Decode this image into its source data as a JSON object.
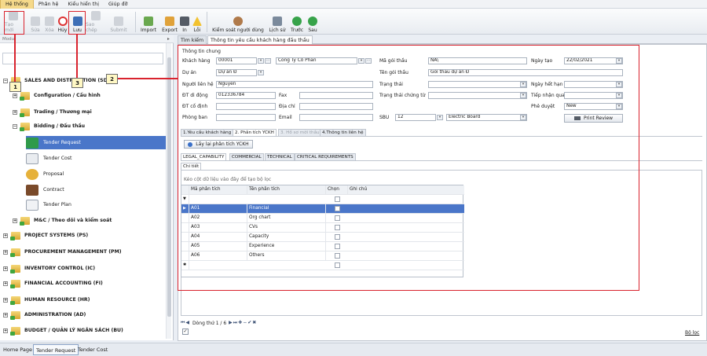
{
  "menu": [
    "Hệ thống",
    "Phân hệ",
    "Kiểu hiển thị",
    "Giúp đỡ"
  ],
  "toolbar": {
    "tao_moi": "Tạo mới",
    "sua": "Sửa",
    "xoa": "Xóa",
    "huy": "Hủy",
    "luu": "Lưu",
    "sao_chep": "Sao chép",
    "submit": "Submit",
    "import": "Import",
    "export": "Export",
    "in": "In",
    "loi": "Lỗi",
    "kiem_soat": "Kiểm soát người dùng",
    "lich_su": "Lịch sử",
    "truoc": "Trước",
    "sau": "Sau"
  },
  "left_panel": {
    "header": "Modu",
    "items": [
      {
        "label": "SALES AND DISTRIBUTION (SD)",
        "level": 0
      },
      {
        "label": "Configuration / Cấu hình",
        "level": 1
      },
      {
        "label": "Trading / Thương mại",
        "level": 1
      },
      {
        "label": "Bidding / Đấu thầu",
        "level": 1
      },
      {
        "label": "Tender Request",
        "level": 2
      },
      {
        "label": "Tender Cost",
        "level": 2
      },
      {
        "label": "Proposal",
        "level": 2
      },
      {
        "label": "Contract",
        "level": 2
      },
      {
        "label": "Tender Plan",
        "level": 2
      },
      {
        "label": "M&C / Theo dõi và kiểm soát",
        "level": 1
      },
      {
        "label": "PROJECT SYSTEMS (PS)",
        "level": 0
      },
      {
        "label": "PROCUREMENT MANAGEMENT (PM)",
        "level": 0
      },
      {
        "label": "INVENTORY CONTROL (IC)",
        "level": 0
      },
      {
        "label": "FINANCIAL ACCOUNTING (FI)",
        "level": 0
      },
      {
        "label": "HUMAN RESOURCE (HR)",
        "level": 0
      },
      {
        "label": "ADMINISTRATION (AD)",
        "level": 0
      },
      {
        "label": "BUDGET / QUẢN LÝ NGÂN SÁCH (BU)",
        "level": 0
      }
    ]
  },
  "tabs": [
    "Tìm kiếm",
    "Thông tin yêu cầu khách hàng đấu thầu"
  ],
  "form": {
    "group_title": "Thông tin chung",
    "khach_hang_label": "Khách hàng",
    "khach_hang_code": "00001",
    "khach_hang_name": "Công Ty Cổ Phần",
    "du_an_label": "Dự án",
    "du_an_value": "Dự án Đ",
    "nguoi_lien_he_label": "Người liên hệ",
    "nguoi_lien_he_value": "Nguyen",
    "dt_di_dong_label": "ĐT di động",
    "dt_di_dong_value": "012336784",
    "fax_label": "Fax",
    "dt_co_dinh_label": "ĐT cố định",
    "dia_chi_label": "Địa chỉ",
    "phong_ban_label": "Phòng ban",
    "email_label": "Email",
    "ma_goi_thau_label": "Mã gói thầu",
    "ma_goi_thau_value": "NA\\",
    "ten_goi_thau_label": "Tên gói thầu",
    "ten_goi_thau_value": "Gói thầu dự án Đ",
    "trang_thai_label": "Trạng thái",
    "trang_thai_ct_label": "Trạng thái chứng từ",
    "sbu_label": "SBU",
    "sbu_value": "12",
    "sbu_name": "Electric Board",
    "ngay_tao_label": "Ngày tạo",
    "ngay_tao_value": "22/02/2021",
    "ngay_het_han_label": "Ngày hết hạn",
    "tiep_nhan_qua_label": "Tiếp nhận qua",
    "phe_duyet_label": "Phê duyệt",
    "phe_duyet_value": "New",
    "print_review": "Print Review"
  },
  "sub_tabs": [
    "1.Yêu cầu khách hàng",
    "2. Phân tích YCKH",
    "3. Hồ sơ mời thầu",
    "4.Thông tin liên hệ"
  ],
  "reload_button": "Lấy lại phân tích YCKH",
  "inner_tabs": [
    "LEGAL_CAPABILITY",
    "COMMERCIAL",
    "TECHNICAL",
    "CRITICAL REQUIREMENTS"
  ],
  "chi_tiet_tab": "Chi tiết",
  "grid": {
    "group_hint": "Kéo cột dữ liệu vào đây để tạo bộ lọc",
    "columns": [
      "Mã phân tích",
      "Tên phân tích",
      "Chọn",
      "Ghi chú"
    ],
    "rows": [
      {
        "code": "A01",
        "name": "Financial"
      },
      {
        "code": "A02",
        "name": "Org chart"
      },
      {
        "code": "A03",
        "name": "CVs"
      },
      {
        "code": "A04",
        "name": "Capacity"
      },
      {
        "code": "A05",
        "name": "Experience"
      },
      {
        "code": "A06",
        "name": "Others"
      }
    ]
  },
  "pager": "Dòng thứ 1 / 6",
  "filter_label": "Bộ lọc",
  "bottom_tabs": [
    "Home Page",
    "Tender Request",
    "Tender Cost"
  ],
  "callouts": [
    "1",
    "2",
    "3"
  ],
  "colors": {
    "accent": "#4a76c9",
    "annotation": "#d9232e",
    "callout_bg": "#fff8c4"
  }
}
